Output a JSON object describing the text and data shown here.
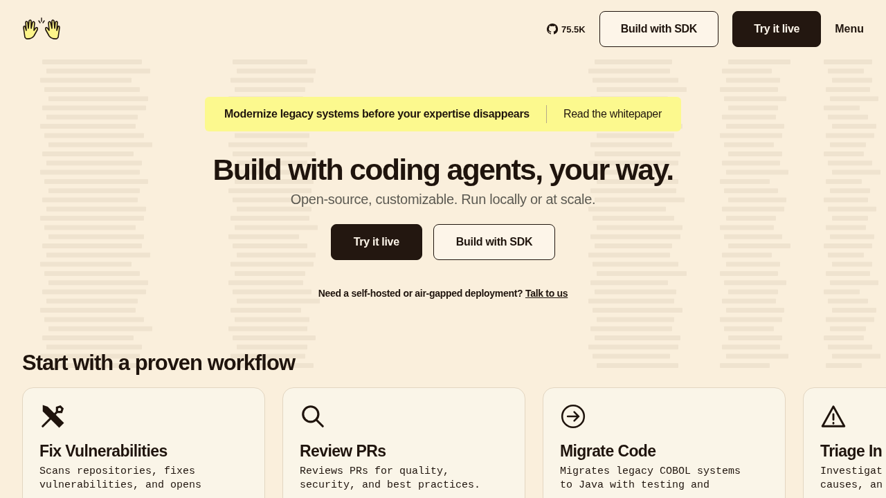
{
  "header": {
    "stars": "75.5K",
    "buttons": [
      {
        "label": "Build with SDK",
        "kind": "outline"
      },
      {
        "label": "Try it live",
        "kind": "solid"
      }
    ],
    "menu": "Menu"
  },
  "banner": {
    "text": "Modernize legacy systems before your expertise disappears",
    "link": "Read the whitepaper"
  },
  "hero": {
    "title": "Build with coding agents, your way.",
    "subtitle": "Open-source, customizable. Run locally or at scale.",
    "buttons": [
      {
        "label": "Try it live",
        "kind": "solid"
      },
      {
        "label": "Build with SDK",
        "kind": "outline"
      }
    ],
    "note": "Need a self-hosted or air-gapped deployment?",
    "note_link": "Talk to us"
  },
  "workflows": {
    "title": "Start with a proven workflow",
    "cards": [
      {
        "kind": "tools",
        "title": "Fix Vulnerabilities",
        "description": [
          "Scans repositories, fixes",
          "vulnerabilities, and opens"
        ]
      },
      {
        "kind": "search",
        "title": "Review PRs",
        "description": [
          "Reviews PRs for quality,",
          "security, and best practices."
        ]
      },
      {
        "kind": "arrow",
        "title": "Migrate Code",
        "description": [
          "Migrates legacy COBOL systems",
          "to Java with testing and"
        ]
      },
      {
        "kind": "warning",
        "title": "Triage In",
        "description": [
          "Investigat",
          "causes, an"
        ]
      }
    ]
  }
}
